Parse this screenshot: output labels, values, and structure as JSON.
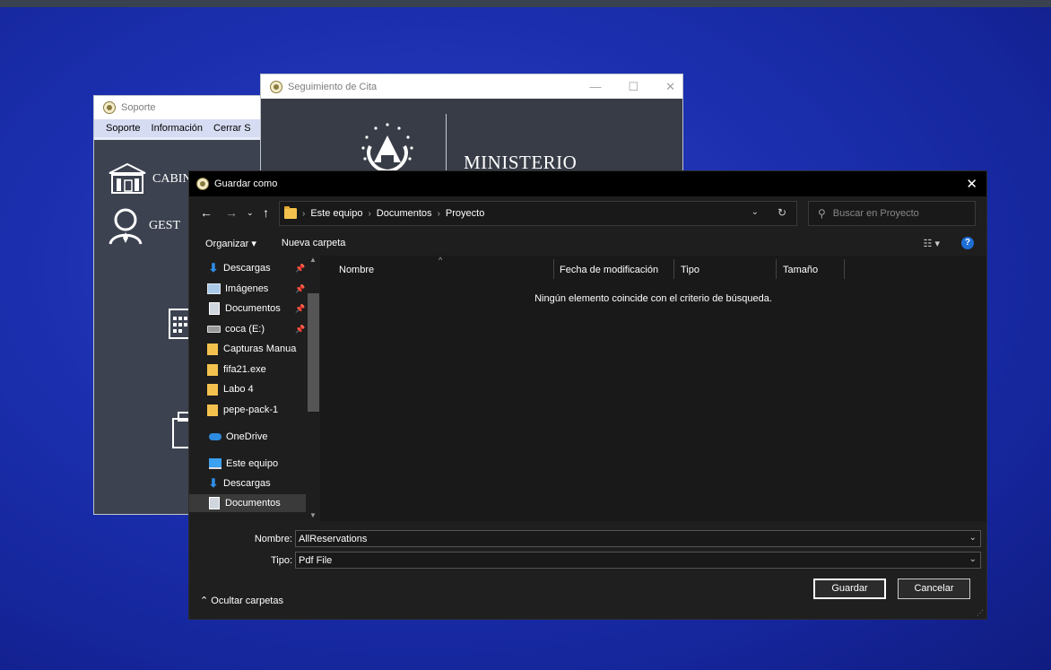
{
  "soporte_window": {
    "title": "Soporte",
    "menu": [
      "Soporte",
      "Información",
      "Cerrar S"
    ],
    "rows": [
      "CABIN",
      "GEST"
    ]
  },
  "seguimiento_window": {
    "title": "Seguimiento de Cita",
    "heading": "MINISTERIO",
    "controls": [
      "—",
      "☐",
      "✕"
    ]
  },
  "dialog": {
    "title": "Guardar como",
    "breadcrumb": [
      "Este equipo",
      "Documentos",
      "Proyecto"
    ],
    "search_placeholder": "Buscar en Proyecto",
    "toolbar": {
      "organize": "Organizar ▾",
      "new_folder": "Nueva carpeta"
    },
    "sidebar": [
      {
        "label": "Descargas",
        "icon": "download-icon",
        "pinned": true
      },
      {
        "label": "Imágenes",
        "icon": "pictures-icon",
        "pinned": true
      },
      {
        "label": "Documentos",
        "icon": "documents-icon",
        "pinned": true
      },
      {
        "label": "coca (E:)",
        "icon": "drive-icon",
        "pinned": true
      },
      {
        "label": "Capturas Manua",
        "icon": "folder-icon",
        "pinned": false
      },
      {
        "label": "fifa21.exe",
        "icon": "folder-icon",
        "pinned": false
      },
      {
        "label": "Labo 4",
        "icon": "folder-icon",
        "pinned": false
      },
      {
        "label": "pepe-pack-1",
        "icon": "folder-icon",
        "pinned": false
      },
      {
        "label": "OneDrive",
        "icon": "onedrive-icon",
        "pinned": false
      },
      {
        "label": "Este equipo",
        "icon": "computer-icon",
        "pinned": false
      },
      {
        "label": "Descargas",
        "icon": "download-icon",
        "pinned": false
      },
      {
        "label": "Documentos",
        "icon": "documents-icon",
        "pinned": false,
        "selected": true
      }
    ],
    "columns": [
      "Nombre",
      "Fecha de modificación",
      "Tipo",
      "Tamaño"
    ],
    "empty_message": "Ningún elemento coincide con el criterio de búsqueda.",
    "filename_label": "Nombre:",
    "filename_value": "AllReservations",
    "type_label": "Tipo:",
    "type_value": "Pdf File",
    "hide_folders": "Ocultar carpetas",
    "save_button": "Guardar",
    "cancel_button": "Cancelar"
  }
}
